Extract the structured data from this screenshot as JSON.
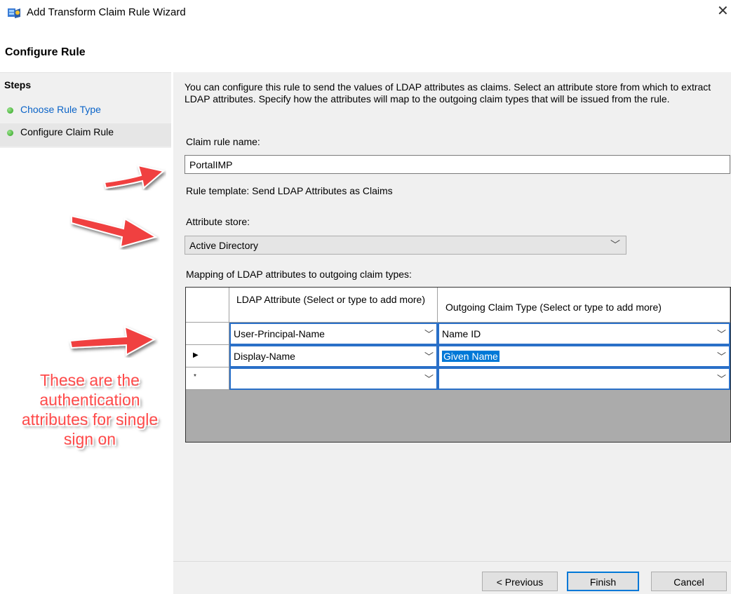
{
  "window": {
    "title": "Add Transform Claim Rule Wizard",
    "close_glyph": "✕",
    "heading": "Configure Rule"
  },
  "steps": {
    "title": "Steps",
    "items": [
      {
        "label": "Choose Rule Type"
      },
      {
        "label": "Configure Claim Rule"
      }
    ]
  },
  "content": {
    "description": "You can configure this rule to send the values of LDAP attributes as claims. Select an attribute store from which to extract LDAP attributes. Specify how the attributes will map to the outgoing claim types that will be issued from the rule.",
    "claim_rule_name_label": "Claim rule name:",
    "claim_rule_name_value": "PortalIMP",
    "rule_template": "Rule template: Send LDAP Attributes as Claims",
    "attribute_store_label": "Attribute store:",
    "attribute_store_value": "Active Directory",
    "mapping_label": "Mapping of LDAP attributes to outgoing claim types:"
  },
  "grid": {
    "columns": [
      "LDAP Attribute (Select or type to add more)",
      "Outgoing Claim Type (Select or type to add more)"
    ],
    "rows": [
      {
        "marker": "",
        "ldap": "User-Principal-Name",
        "claim": "Name ID"
      },
      {
        "marker": "▶",
        "ldap": "Display-Name",
        "claim": "Given Name"
      },
      {
        "marker": "*",
        "ldap": "",
        "claim": ""
      }
    ]
  },
  "buttons": {
    "previous": "< Previous",
    "finish": "Finish",
    "cancel": "Cancel"
  },
  "annotation": {
    "text": "These are the authentication attributes for single sign on",
    "color": "#ff4a4a"
  },
  "colors": {
    "accent": "#0078d7",
    "step_active": "#2aa21a",
    "link": "#0b64c8"
  },
  "icons": [
    "wizard-app-icon",
    "close-icon",
    "chevron-down-icon",
    "row-pointer-icon",
    "new-row-icon",
    "red-arrow-icon"
  ]
}
